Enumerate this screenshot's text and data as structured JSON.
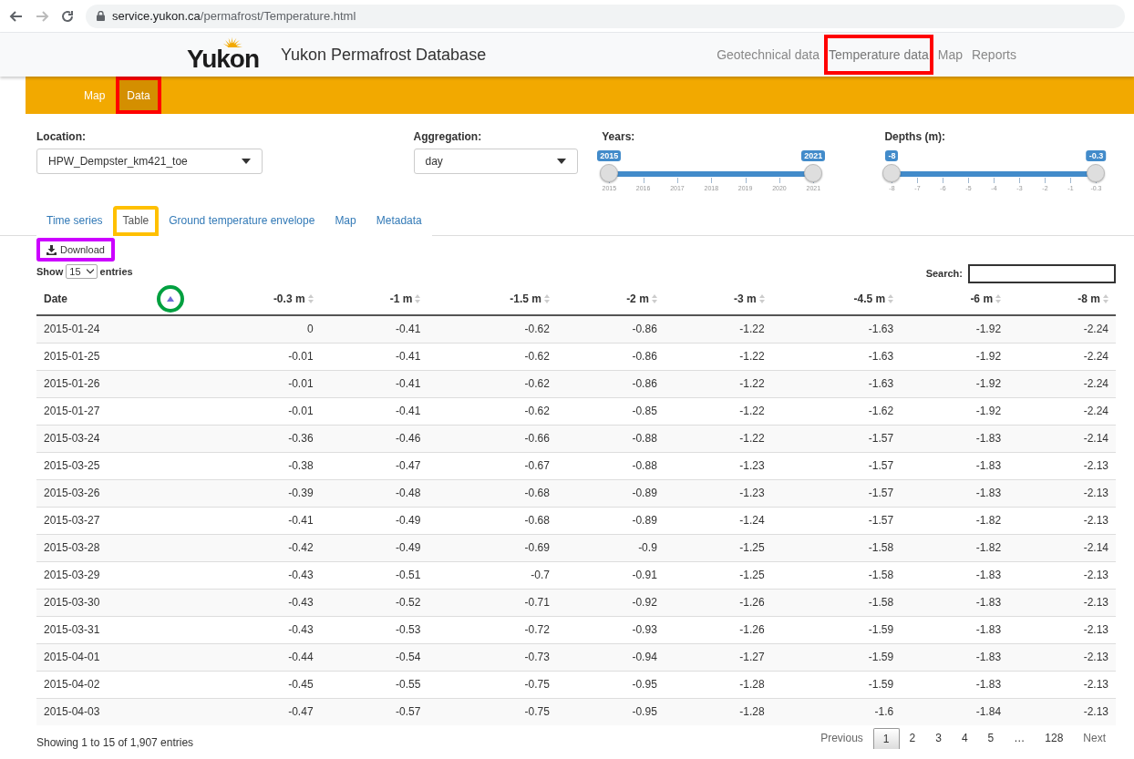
{
  "browser": {
    "url_host": "service.yukon.ca",
    "url_path": "/permafrost/Temperature.html"
  },
  "header": {
    "logo": "Yukon",
    "title": "Yukon Permafrost Database",
    "nav": [
      {
        "label": "Geotechnical data",
        "selected": false,
        "highlighted": false
      },
      {
        "label": "Temperature data",
        "selected": true,
        "highlighted": true
      },
      {
        "label": "Map",
        "selected": false,
        "highlighted": false
      },
      {
        "label": "Reports",
        "selected": false,
        "highlighted": false
      }
    ]
  },
  "subnav": [
    {
      "label": "Map",
      "selected": false,
      "highlighted": false
    },
    {
      "label": "Data",
      "selected": true,
      "highlighted": true
    }
  ],
  "controls": {
    "location": {
      "label": "Location:",
      "value": "HPW_Dempster_km421_toe"
    },
    "aggregation": {
      "label": "Aggregation:",
      "value": "day"
    },
    "sliders": [
      {
        "label": "Years:",
        "thumbs": [
          "2015",
          "2021"
        ],
        "ticks": [
          "2015",
          "2016",
          "2017",
          "2018",
          "2019",
          "2020",
          "2021"
        ]
      },
      {
        "label": "Depths (m):",
        "thumbs": [
          "-8",
          "-0.3"
        ],
        "ticks": [
          "-8",
          "-7",
          "-6",
          "-5",
          "-4",
          "-3",
          "-2",
          "-1",
          "-0.3"
        ]
      }
    ]
  },
  "tabs": [
    {
      "label": "Time series",
      "selected": false,
      "highlighted": false
    },
    {
      "label": "Table",
      "selected": true,
      "highlighted": true
    },
    {
      "label": "Ground temperature envelope",
      "selected": false,
      "highlighted": false
    },
    {
      "label": "Map",
      "selected": false,
      "highlighted": false
    },
    {
      "label": "Metadata",
      "selected": false,
      "highlighted": false
    }
  ],
  "download": {
    "label": "Download",
    "highlighted": true
  },
  "length": {
    "show": "Show",
    "value": "15",
    "entries": "entries"
  },
  "search": {
    "label": "Search:"
  },
  "table": {
    "columns": [
      {
        "label": "Date",
        "sorted": true,
        "highlighted": true
      },
      {
        "label": "-0.3 m",
        "sorted": false,
        "highlighted": false
      },
      {
        "label": "-1 m",
        "sorted": false,
        "highlighted": false
      },
      {
        "label": "-1.5 m",
        "sorted": false,
        "highlighted": false
      },
      {
        "label": "-2 m",
        "sorted": false,
        "highlighted": false
      },
      {
        "label": "-3 m",
        "sorted": false,
        "highlighted": false
      },
      {
        "label": "-4.5 m",
        "sorted": false,
        "highlighted": false
      },
      {
        "label": "-6 m",
        "sorted": false,
        "highlighted": false
      },
      {
        "label": "-8 m",
        "sorted": false,
        "highlighted": false
      }
    ],
    "rows": [
      [
        "2015-01-24",
        "0",
        "-0.41",
        "-0.62",
        "-0.86",
        "-1.22",
        "-1.63",
        "-1.92",
        "-2.24"
      ],
      [
        "2015-01-25",
        "-0.01",
        "-0.41",
        "-0.62",
        "-0.86",
        "-1.22",
        "-1.63",
        "-1.92",
        "-2.24"
      ],
      [
        "2015-01-26",
        "-0.01",
        "-0.41",
        "-0.62",
        "-0.86",
        "-1.22",
        "-1.63",
        "-1.92",
        "-2.24"
      ],
      [
        "2015-01-27",
        "-0.01",
        "-0.41",
        "-0.62",
        "-0.85",
        "-1.22",
        "-1.62",
        "-1.92",
        "-2.24"
      ],
      [
        "2015-03-24",
        "-0.36",
        "-0.46",
        "-0.66",
        "-0.88",
        "-1.22",
        "-1.57",
        "-1.83",
        "-2.14"
      ],
      [
        "2015-03-25",
        "-0.38",
        "-0.47",
        "-0.67",
        "-0.88",
        "-1.23",
        "-1.57",
        "-1.83",
        "-2.13"
      ],
      [
        "2015-03-26",
        "-0.39",
        "-0.48",
        "-0.68",
        "-0.89",
        "-1.23",
        "-1.57",
        "-1.83",
        "-2.13"
      ],
      [
        "2015-03-27",
        "-0.41",
        "-0.49",
        "-0.68",
        "-0.89",
        "-1.24",
        "-1.57",
        "-1.82",
        "-2.13"
      ],
      [
        "2015-03-28",
        "-0.42",
        "-0.49",
        "-0.69",
        "-0.9",
        "-1.25",
        "-1.58",
        "-1.82",
        "-2.14"
      ],
      [
        "2015-03-29",
        "-0.43",
        "-0.51",
        "-0.7",
        "-0.91",
        "-1.25",
        "-1.58",
        "-1.83",
        "-2.13"
      ],
      [
        "2015-03-30",
        "-0.43",
        "-0.52",
        "-0.71",
        "-0.92",
        "-1.26",
        "-1.58",
        "-1.83",
        "-2.13"
      ],
      [
        "2015-03-31",
        "-0.43",
        "-0.53",
        "-0.72",
        "-0.93",
        "-1.26",
        "-1.59",
        "-1.83",
        "-2.13"
      ],
      [
        "2015-04-01",
        "-0.44",
        "-0.54",
        "-0.73",
        "-0.94",
        "-1.27",
        "-1.59",
        "-1.83",
        "-2.13"
      ],
      [
        "2015-04-02",
        "-0.45",
        "-0.55",
        "-0.75",
        "-0.95",
        "-1.28",
        "-1.59",
        "-1.83",
        "-2.13"
      ],
      [
        "2015-04-03",
        "-0.47",
        "-0.57",
        "-0.75",
        "-0.95",
        "-1.28",
        "-1.6",
        "-1.84",
        "-2.13"
      ]
    ]
  },
  "info": "Showing 1 to 15 of 1,907 entries",
  "pagination": [
    {
      "label": "Previous",
      "kind": "link",
      "selected": false
    },
    {
      "label": "1",
      "kind": "page",
      "selected": true
    },
    {
      "label": "2",
      "kind": "page",
      "selected": false
    },
    {
      "label": "3",
      "kind": "page",
      "selected": false
    },
    {
      "label": "4",
      "kind": "page",
      "selected": false
    },
    {
      "label": "5",
      "kind": "page",
      "selected": false
    },
    {
      "label": "…",
      "kind": "ellipsis",
      "selected": false
    },
    {
      "label": "128",
      "kind": "page",
      "selected": false
    },
    {
      "label": "Next",
      "kind": "link",
      "selected": false
    }
  ]
}
